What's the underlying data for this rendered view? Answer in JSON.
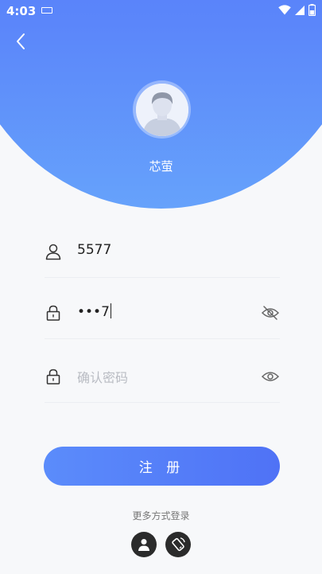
{
  "status_bar": {
    "time": "4:03"
  },
  "header": {
    "username": "芯萤"
  },
  "form": {
    "account": {
      "value": "5577"
    },
    "password": {
      "value": "•••7"
    },
    "confirm_password": {
      "value": "",
      "placeholder": "确认密码"
    }
  },
  "register_button": {
    "label": "注 册"
  },
  "more_login": {
    "label": "更多方式登录"
  },
  "colors": {
    "primary": "#4f72f6",
    "primary_light": "#66a2fb",
    "social_bg": "#2b2b2b"
  }
}
